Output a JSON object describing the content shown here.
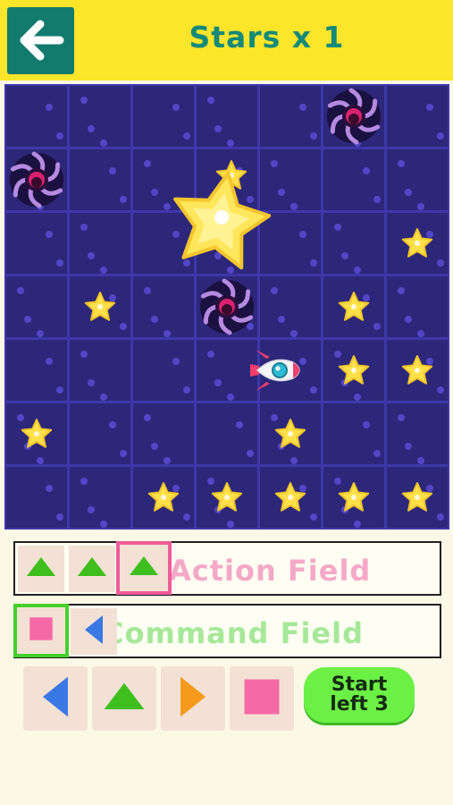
{
  "header": {
    "title": "Stars x 1",
    "back_icon": "arrow-left-icon",
    "background": "#fde52a",
    "title_color": "#148a78"
  },
  "board": {
    "rows": 7,
    "cols": 7,
    "cell_color": "#2d2779",
    "grid_color": "#3e37a8",
    "pieces": [
      {
        "type": "black-hole",
        "row": 0,
        "col": 5
      },
      {
        "type": "black-hole",
        "row": 1,
        "col": 0
      },
      {
        "type": "black-hole",
        "row": 3,
        "col": 3
      },
      {
        "type": "star",
        "row": 1,
        "col": 3
      },
      {
        "type": "big-star",
        "row": 2,
        "col": 3
      },
      {
        "type": "star",
        "row": 2,
        "col": 6
      },
      {
        "type": "star",
        "row": 3,
        "col": 1
      },
      {
        "type": "star",
        "row": 3,
        "col": 5
      },
      {
        "type": "rocket",
        "row": 4,
        "col": 4
      },
      {
        "type": "star",
        "row": 4,
        "col": 5
      },
      {
        "type": "star",
        "row": 4,
        "col": 6
      },
      {
        "type": "star",
        "row": 5,
        "col": 0
      },
      {
        "type": "star",
        "row": 5,
        "col": 4
      },
      {
        "type": "star",
        "row": 6,
        "col": 2
      },
      {
        "type": "star",
        "row": 6,
        "col": 3
      },
      {
        "type": "star",
        "row": 6,
        "col": 4
      },
      {
        "type": "star",
        "row": 6,
        "col": 5
      },
      {
        "type": "star",
        "row": 6,
        "col": 6
      }
    ]
  },
  "action_field": {
    "label": "Action Field",
    "slots": [
      "up-arrow-icon",
      "up-arrow-icon",
      "up-arrow-icon"
    ],
    "selected_index": 2
  },
  "command_field": {
    "label": "Command Field",
    "slots": [
      "stop-square-icon",
      "left-arrow-icon"
    ],
    "selected_index": 0
  },
  "controls": {
    "buttons": [
      "left-arrow-icon",
      "up-arrow-icon",
      "right-arrow-icon",
      "stop-square-icon"
    ],
    "start_line1": "Start",
    "start_line2": "left 3"
  },
  "colors": {
    "left_arrow": "#3a78e4",
    "up_arrow": "#3fbf1e",
    "right_arrow": "#f59a1c",
    "stop_square": "#f56aa6",
    "star": "#ffe047"
  }
}
